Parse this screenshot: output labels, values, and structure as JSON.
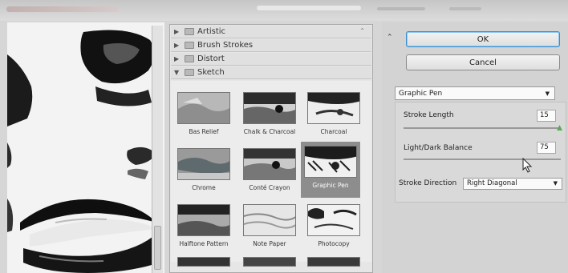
{
  "categories": [
    {
      "label": "Artistic",
      "expanded": false
    },
    {
      "label": "Brush Strokes",
      "expanded": false
    },
    {
      "label": "Distort",
      "expanded": false
    },
    {
      "label": "Sketch",
      "expanded": true
    }
  ],
  "sketch_filters": [
    {
      "label": "Bas Relief"
    },
    {
      "label": "Chalk & Charcoal"
    },
    {
      "label": "Charcoal"
    },
    {
      "label": "Chrome"
    },
    {
      "label": "Conté Crayon"
    },
    {
      "label": "Graphic Pen",
      "selected": true
    },
    {
      "label": "Halftone Pattern"
    },
    {
      "label": "Note Paper"
    },
    {
      "label": "Photocopy"
    }
  ],
  "buttons": {
    "ok": "OK",
    "cancel": "Cancel"
  },
  "filter_select": {
    "value": "Graphic Pen"
  },
  "options": {
    "stroke_length": {
      "label": "Stroke Length",
      "value": "15"
    },
    "light_dark_balance": {
      "label": "Light/Dark Balance",
      "value": "75"
    },
    "stroke_direction": {
      "label": "Stroke Direction",
      "value": "Right Diagonal"
    }
  },
  "icons": {
    "collapse": "double-chevron-up-icon",
    "folder": "folder-icon",
    "dropdown": "chevron-down-icon"
  }
}
